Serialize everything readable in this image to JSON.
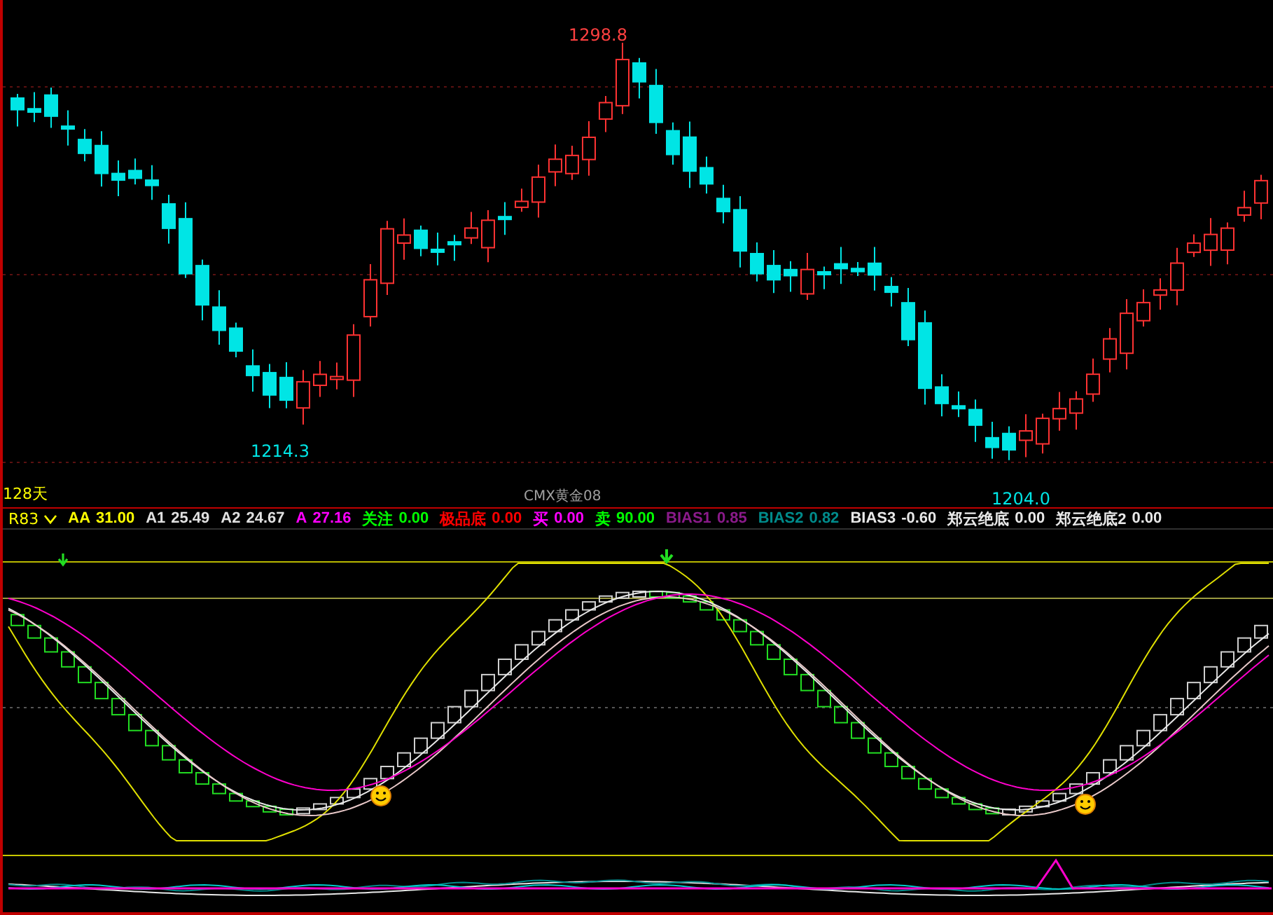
{
  "price_panel": {
    "extreme_labels": [
      {
        "text": "1298.8",
        "kind": "high"
      },
      {
        "text": "1214.3",
        "kind": "low"
      },
      {
        "text": "1204.0",
        "kind": "low"
      }
    ],
    "period": "128天",
    "symbol": "CMX黄金08"
  },
  "indicator_bar": {
    "name": "R83",
    "items": [
      {
        "label": "AA",
        "value": "31.00",
        "color": "#ffff00"
      },
      {
        "label": "A1",
        "value": "25.49",
        "color": "#e0e0e0"
      },
      {
        "label": "A2",
        "value": "24.67",
        "color": "#e0e0e0"
      },
      {
        "label": "A",
        "value": "27.16",
        "color": "#ff00ff"
      },
      {
        "label": "关注",
        "value": "0.00",
        "color": "#00ff00"
      },
      {
        "label": "极品底",
        "value": "0.00",
        "color": "#ff0000"
      },
      {
        "label": "买",
        "value": "0.00",
        "color": "#ff00ff"
      },
      {
        "label": "卖",
        "value": "90.00",
        "color": "#00ff00"
      },
      {
        "label": "BIAS1",
        "value": "0.85",
        "color": "#8a1a8a"
      },
      {
        "label": "BIAS2",
        "value": "0.82",
        "color": "#008b8b"
      },
      {
        "label": "BIAS3",
        "value": "-0.60",
        "color": "#e8e8e8"
      },
      {
        "label": "郑云绝底",
        "value": "0.00",
        "color": "#e8e8e8"
      },
      {
        "label": "郑云绝底2",
        "value": "0.00",
        "color": "#e8e8e8"
      }
    ]
  }
}
